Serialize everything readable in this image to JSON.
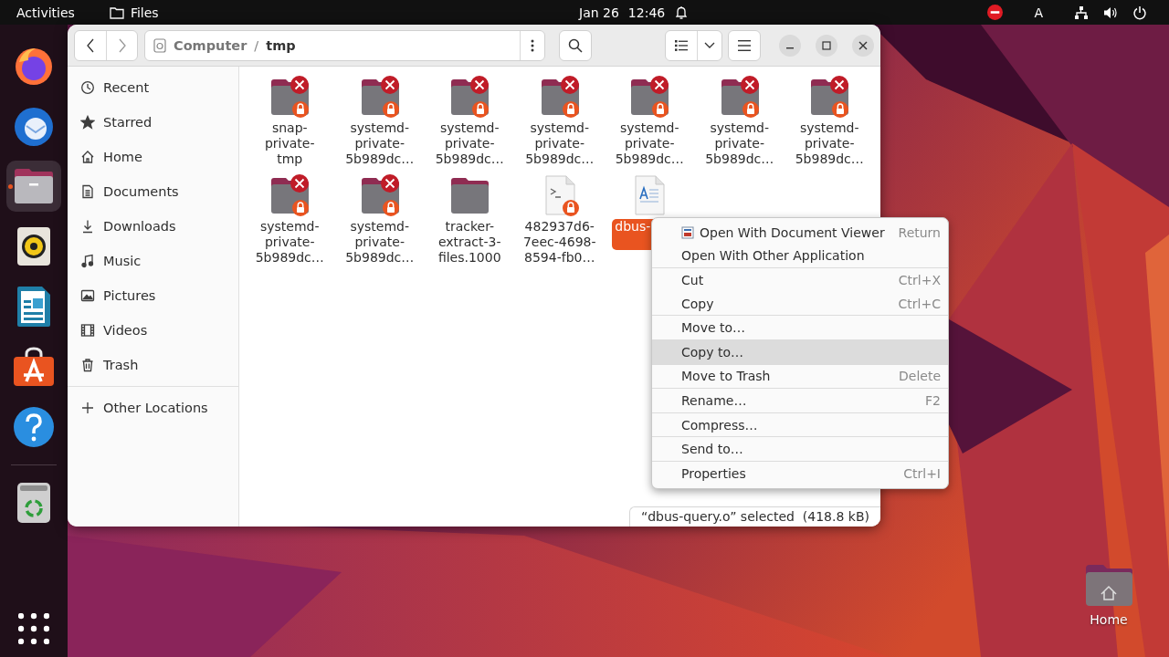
{
  "top_bar": {
    "activities": "Activities",
    "app_name": "Files",
    "date": "Jan 26",
    "time": "12:46",
    "keyboard_layout": "A"
  },
  "dock": {
    "favorites": [
      {
        "kind": "browser",
        "running": false
      },
      {
        "kind": "mail",
        "running": false
      },
      {
        "kind": "files",
        "running": true
      },
      {
        "kind": "music",
        "running": false
      },
      {
        "kind": "writer",
        "running": false
      },
      {
        "kind": "store",
        "running": false
      },
      {
        "kind": "help",
        "running": false
      }
    ],
    "mounted": [
      {
        "kind": "trash",
        "running": false
      }
    ]
  },
  "window": {
    "path_separator": "/",
    "path": [
      {
        "label": "Computer",
        "selected": false
      },
      {
        "label": "tmp",
        "selected": true
      }
    ],
    "sidebar": {
      "places": [
        {
          "kind": "recent",
          "label": "Recent"
        },
        {
          "kind": "starred",
          "label": "Starred"
        },
        {
          "kind": "home",
          "label": "Home"
        },
        {
          "kind": "documents",
          "label": "Documents"
        },
        {
          "kind": "downloads",
          "label": "Downloads"
        },
        {
          "kind": "music",
          "label": "Music"
        },
        {
          "kind": "pictures",
          "label": "Pictures"
        },
        {
          "kind": "videos",
          "label": "Videos"
        },
        {
          "kind": "trash",
          "label": "Trash"
        }
      ],
      "other_locations": "Other Locations"
    },
    "files": [
      {
        "kind": "folder",
        "no_access": true,
        "locked": true,
        "selected": false,
        "lines": [
          "snap-",
          "private-",
          "tmp"
        ]
      },
      {
        "kind": "folder",
        "no_access": true,
        "locked": true,
        "selected": false,
        "lines": [
          "systemd-",
          "private-",
          "5b989dc…"
        ]
      },
      {
        "kind": "folder",
        "no_access": true,
        "locked": true,
        "selected": false,
        "lines": [
          "systemd-",
          "private-",
          "5b989dc…"
        ]
      },
      {
        "kind": "folder",
        "no_access": true,
        "locked": true,
        "selected": false,
        "lines": [
          "systemd-",
          "private-",
          "5b989dc…"
        ]
      },
      {
        "kind": "folder",
        "no_access": true,
        "locked": true,
        "selected": false,
        "lines": [
          "systemd-",
          "private-",
          "5b989dc…"
        ]
      },
      {
        "kind": "folder",
        "no_access": true,
        "locked": true,
        "selected": false,
        "lines": [
          "systemd-",
          "private-",
          "5b989dc…"
        ]
      },
      {
        "kind": "folder",
        "no_access": true,
        "locked": true,
        "selected": false,
        "lines": [
          "systemd-",
          "private-",
          "5b989dc…"
        ]
      },
      {
        "kind": "folder",
        "no_access": true,
        "locked": true,
        "selected": false,
        "lines": [
          "systemd-",
          "private-",
          "5b989dc…"
        ]
      },
      {
        "kind": "folder",
        "no_access": true,
        "locked": true,
        "selected": false,
        "lines": [
          "systemd-",
          "private-",
          "5b989dc…"
        ]
      },
      {
        "kind": "folder",
        "no_access": false,
        "locked": false,
        "selected": false,
        "lines": [
          "tracker-",
          "extract-3-",
          "files.1000"
        ]
      },
      {
        "kind": "script",
        "no_access": false,
        "locked": true,
        "selected": false,
        "lines": [
          "482937d6-",
          "7eec-4698-",
          "8594-fb0…"
        ]
      },
      {
        "kind": "document",
        "no_access": false,
        "locked": false,
        "selected": true,
        "lines": [
          "dbus-"
        ]
      }
    ],
    "status": "“dbus-query.o” selected  (418.8 kB)"
  },
  "context_menu": {
    "sections": [
      [
        {
          "label": "Open With Document Viewer",
          "shortcut": "Return",
          "icon": true,
          "selected": false
        },
        {
          "label": "Open With Other Application",
          "icon": false,
          "selected": false
        }
      ],
      [
        {
          "label": "Cut",
          "shortcut": "Ctrl+X",
          "icon": false,
          "selected": false
        },
        {
          "label": "Copy",
          "shortcut": "Ctrl+C",
          "icon": false,
          "selected": false
        }
      ],
      [
        {
          "label": "Move to…",
          "icon": false,
          "selected": false
        }
      ],
      [
        {
          "label": "Copy to…",
          "icon": false,
          "selected": true
        }
      ],
      [
        {
          "label": "Move to Trash",
          "shortcut": "Delete",
          "icon": false,
          "selected": false
        }
      ],
      [
        {
          "label": "Rename…",
          "shortcut": "F2",
          "icon": false,
          "selected": false
        }
      ],
      [
        {
          "label": "Compress…",
          "icon": false,
          "selected": false
        }
      ],
      [
        {
          "label": "Send to…",
          "icon": false,
          "selected": false
        }
      ],
      [
        {
          "label": "Properties",
          "shortcut": "Ctrl+I",
          "icon": false,
          "selected": false
        }
      ]
    ]
  },
  "desktop_icons": [
    {
      "label": "Home"
    }
  ]
}
